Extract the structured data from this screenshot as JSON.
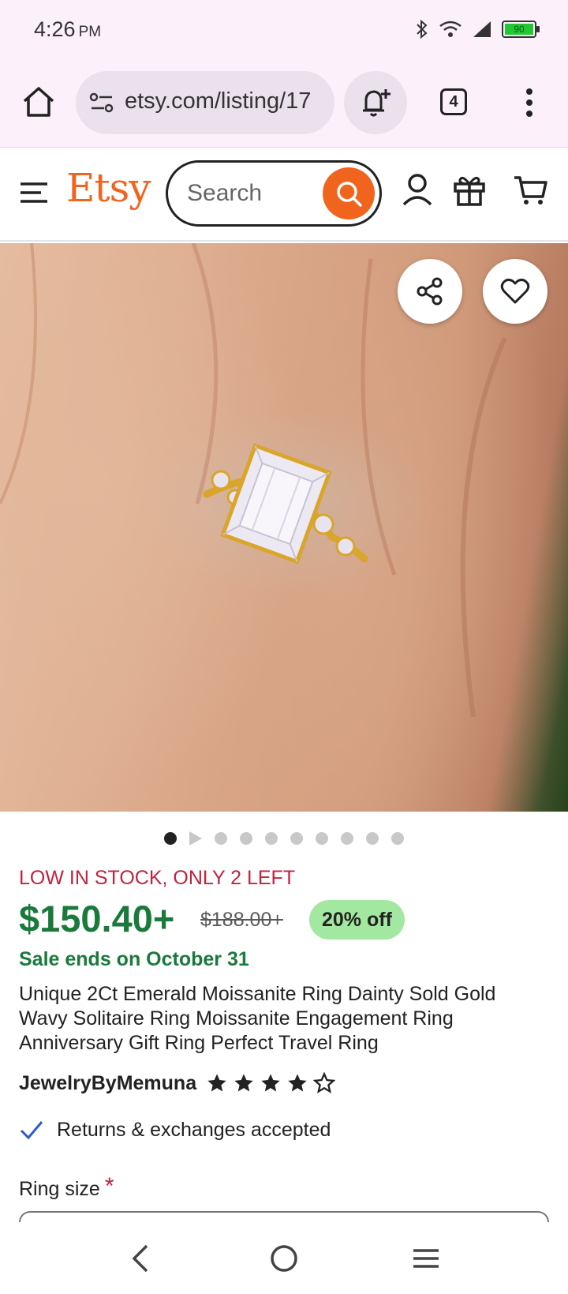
{
  "status_bar": {
    "time": "4:26",
    "ampm": "PM",
    "battery": "90",
    "icons": [
      "bluetooth-icon",
      "wifi-icon",
      "signal-icon",
      "battery-icon"
    ]
  },
  "browser": {
    "url": "etsy.com/listing/17",
    "tab_count": "4"
  },
  "header": {
    "logo": "Etsy",
    "search_placeholder": "Search"
  },
  "gallery": {
    "total_dots": 10,
    "active_index": 0
  },
  "listing": {
    "stock_notice": "LOW IN STOCK, ONLY 2 LEFT",
    "price": "$150.40+",
    "original_price": "$188.00+",
    "discount_badge": "20% off",
    "sale_ends": "Sale ends on October 31",
    "title": "Unique 2Ct Emerald Moissanite Ring Dainty Sold Gold Wavy Solitaire Ring Moissanite Engagement Ring Anniversary Gift Ring Perfect Travel Ring",
    "shop_name": "JewelryByMemuna",
    "rating_stars": 4,
    "rating_max": 5,
    "returns": "Returns & exchanges accepted",
    "ring_size_label": "Ring size",
    "required_marker": "*"
  },
  "colors": {
    "etsy_orange": "#f1641e",
    "price_green": "#1a7a3c",
    "stock_red": "#c3223f",
    "badge_green": "#a3e8a0"
  }
}
